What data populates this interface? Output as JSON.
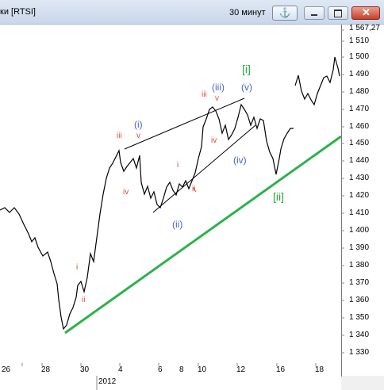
{
  "window": {
    "title": "ки [RTSI]",
    "timeframe": "30 минут",
    "anchor_icon": "⚓",
    "minimize_icon": "minimize-icon",
    "maximize_icon": "maximize-icon",
    "close_icon": "close-icon"
  },
  "axis": {
    "price_ticks": [
      "1 567,27",
      "1 510",
      "1 500",
      "1 490",
      "1 480",
      "1 470",
      "1 460",
      "1 450",
      "1 440",
      "1 430",
      "1 420",
      "1 410",
      "1 400",
      "1 390",
      "1 380",
      "1 370",
      "1 360",
      "1 350",
      "1 340",
      "1 330"
    ],
    "date_ticks": [
      "26",
      "28",
      "30",
      "4",
      "6",
      "8",
      "10",
      "12",
      "16",
      "18"
    ],
    "year": "2012"
  },
  "labels": {
    "wave_i_big": "[i]",
    "wave_ii_big": "[ii]",
    "wave_1": "(i)",
    "wave_2": "(ii)",
    "wave_3": "(iii)",
    "wave_4": "(iv)",
    "wave_5": "(v)",
    "sub_i1": "i",
    "sub_ii1": "ii",
    "sub_iii1": "iii",
    "sub_iv1": "iv",
    "sub_v1": "v",
    "sub_i2": "i",
    "sub_ii2": "ii",
    "sub_iii2": "iii",
    "sub_iv2": "iv",
    "sub_v2": "v"
  },
  "colors": {
    "bg": "#ffffff",
    "price": "#000000",
    "trend_green": "#2bb24c",
    "label_blue": "#4a5fd0",
    "label_red": "#e0483d",
    "label_green": "#2aa838"
  }
}
